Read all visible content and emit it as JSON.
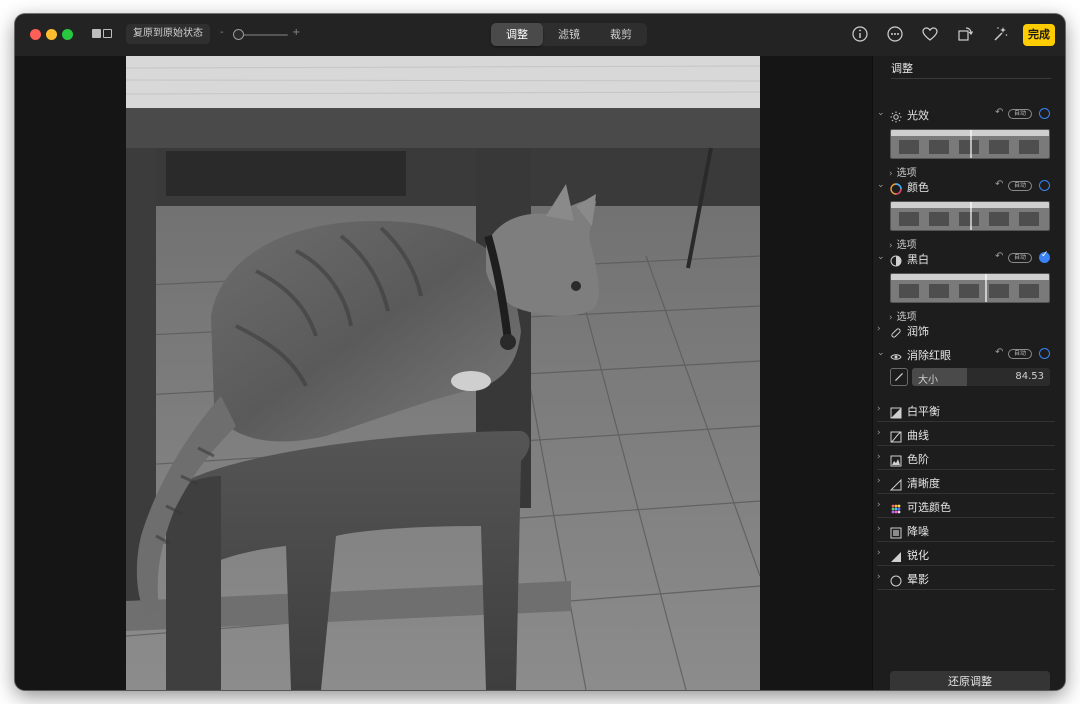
{
  "toolbar": {
    "revert_label": "复原到原始状态",
    "zoom_minus": "-",
    "zoom_plus": "+",
    "zoom_level": 0.0,
    "tabs": [
      {
        "label": "调整",
        "active": true
      },
      {
        "label": "滤镜",
        "active": false
      },
      {
        "label": "裁剪",
        "active": false
      }
    ],
    "done_label": "完成",
    "icons": [
      "info-icon",
      "more-icon",
      "heart-icon",
      "rotate-icon",
      "magic-wand-icon"
    ]
  },
  "sidebar": {
    "title": "调整",
    "sections": [
      {
        "label": "光效",
        "icon": "sun-icon",
        "expanded": true,
        "auto": "自动",
        "enabled": false,
        "options": "选项"
      },
      {
        "label": "颜色",
        "icon": "color-wheel-icon",
        "expanded": true,
        "auto": "自动",
        "enabled": false,
        "options": "选项"
      },
      {
        "label": "黑白",
        "icon": "half-circle-icon",
        "expanded": true,
        "auto": "自动",
        "enabled": true,
        "options": "选项"
      },
      {
        "label": "润饰",
        "icon": "bandage-icon",
        "expanded": false
      },
      {
        "label": "消除红眼",
        "icon": "eye-icon",
        "expanded": true,
        "auto": "自动",
        "enabled": false
      }
    ],
    "redeye_size": {
      "label": "大小",
      "value": "84.53",
      "fill_fraction": 0.4
    },
    "collapsed": [
      {
        "label": "白平衡",
        "icon": "white-balance-icon"
      },
      {
        "label": "曲线",
        "icon": "curves-icon"
      },
      {
        "label": "色阶",
        "icon": "levels-icon"
      },
      {
        "label": "清晰度",
        "icon": "definition-icon"
      },
      {
        "label": "可选颜色",
        "icon": "selective-color-icon"
      },
      {
        "label": "降噪",
        "icon": "noise-reduction-icon"
      },
      {
        "label": "锐化",
        "icon": "sharpen-icon"
      },
      {
        "label": "晕影",
        "icon": "vignette-icon"
      }
    ],
    "reset_label": "还原调整"
  },
  "colors": {
    "accent_blue": "#3b82f6",
    "done_yellow": "#ffcc00"
  }
}
